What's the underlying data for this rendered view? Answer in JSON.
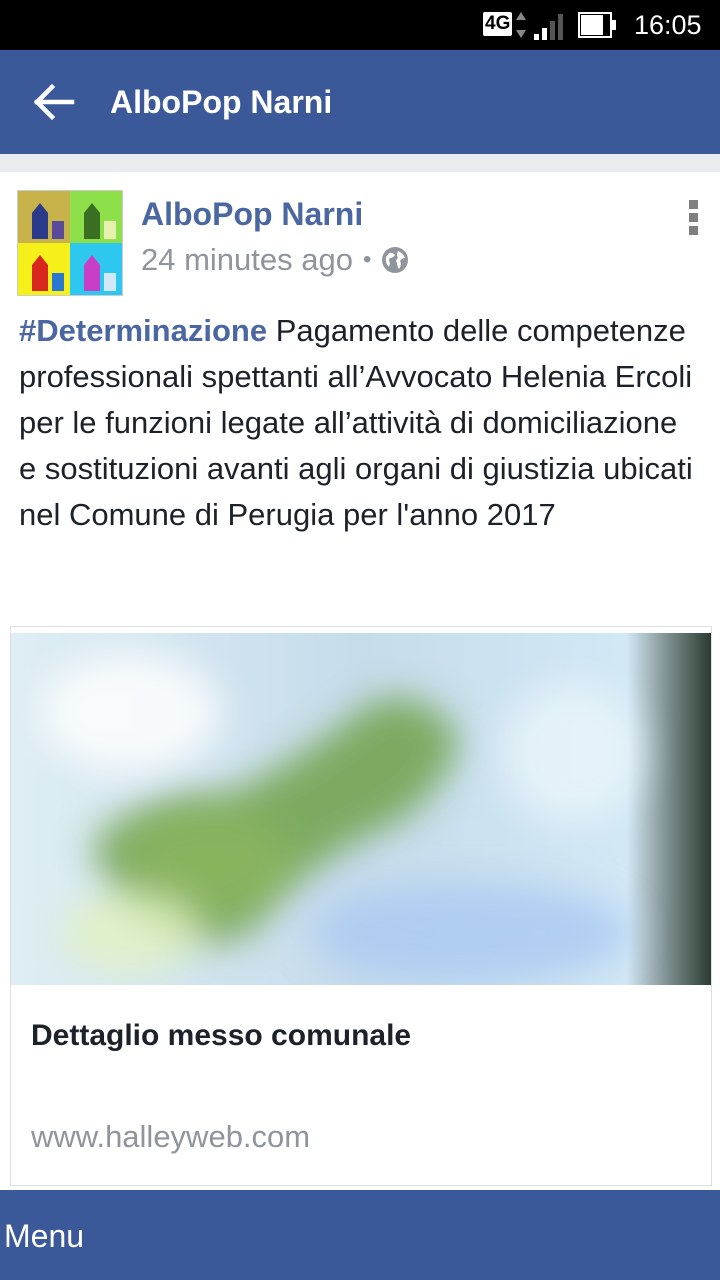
{
  "status_bar": {
    "network": "4G",
    "time": "16:05"
  },
  "app_bar": {
    "title": "AlboPop Narni",
    "back_icon": "arrow-left-icon"
  },
  "post": {
    "author": "AlboPop Narni",
    "timestamp": "24 minutes ago",
    "separator": "•",
    "privacy_icon": "globe-icon",
    "hashtag": "#Determinazione",
    "text": " Pagamento delle competenze professionali spettanti all’Avvocato Helenia Ercoli per le funzioni legate all’attività di domiciliazione e sostituzioni avanti agli organi di giustizia ubicati nel Comune di Perugia per l'anno 2017",
    "link": {
      "title": "Dettaglio messo comunale",
      "domain": "www.halleyweb.com"
    }
  },
  "bottom_bar": {
    "menu_label": "Menu"
  },
  "colors": {
    "brand": "#3b5998",
    "author_link": "#4b67a1",
    "meta_text": "#90949c"
  }
}
